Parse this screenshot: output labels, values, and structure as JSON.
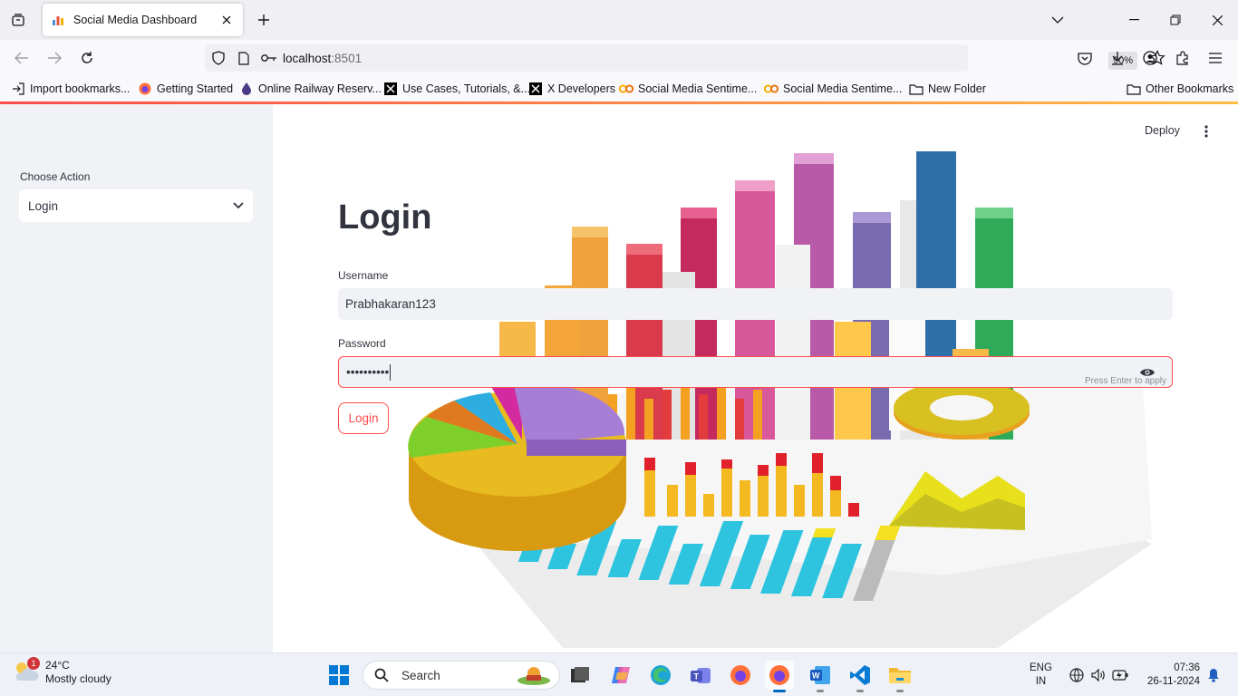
{
  "browser": {
    "tab_title": "Social Media Dashboard",
    "url_host": "localhost",
    "url_port": ":8501",
    "zoom": "90%",
    "bookmarks": [
      {
        "label": "Import bookmarks...",
        "icon": "import-icon"
      },
      {
        "label": "Getting Started",
        "icon": "firefox-icon"
      },
      {
        "label": "Online Railway Reserv...",
        "icon": "railway-icon"
      },
      {
        "label": "Use Cases, Tutorials, &...",
        "icon": "x-icon"
      },
      {
        "label": "X Developers",
        "icon": "x-icon"
      },
      {
        "label": "Social Media Sentime...",
        "icon": "colab-icon"
      },
      {
        "label": "Social Media Sentime...",
        "icon": "colab-icon"
      },
      {
        "label": "New Folder",
        "icon": "folder-icon"
      }
    ],
    "other_bookmarks": "Other Bookmarks"
  },
  "app": {
    "deploy_label": "Deploy",
    "sidebar": {
      "label": "Choose Action",
      "selected": "Login"
    },
    "login": {
      "title": "Login",
      "username_label": "Username",
      "username_value": "Prabhakaran123",
      "password_label": "Password",
      "password_masked": "••••••••••",
      "hint": "Press Enter to apply",
      "button": "Login"
    },
    "accent_color": "#ff4b4b"
  },
  "taskbar": {
    "weather_temp": "24°C",
    "weather_desc": "Mostly cloudy",
    "weather_badge": "1",
    "search_placeholder": "Search",
    "lang_line1": "ENG",
    "lang_line2": "IN",
    "time": "07:36",
    "date": "26-11-2024"
  }
}
